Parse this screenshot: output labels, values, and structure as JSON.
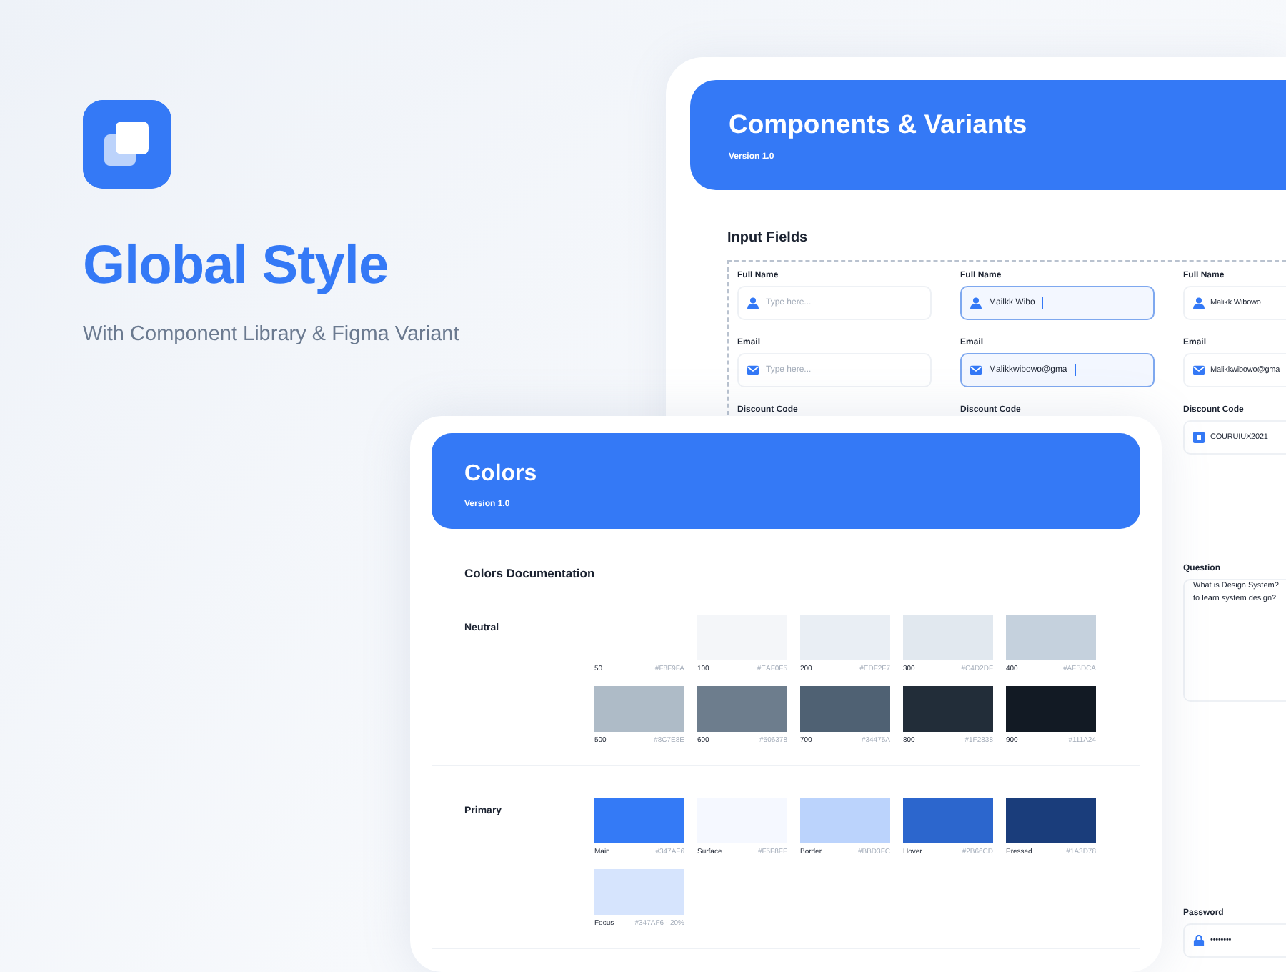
{
  "hero": {
    "title": "Global Style",
    "subtitle": "With Component Library & Figma Variant"
  },
  "components_card": {
    "title": "Components & Variants",
    "version": "Version 1.0",
    "section_title": "Input Fields",
    "columns": [
      {
        "fields": [
          {
            "label": "Full Name",
            "input": {
              "kind": "name",
              "placeholder": "Type here...",
              "focused": false
            }
          },
          {
            "label": "Email",
            "input": {
              "kind": "email",
              "placeholder": "Type here...",
              "focused": false
            }
          },
          {
            "label": "Discount Code"
          }
        ]
      },
      {
        "fields": [
          {
            "label": "Full Name",
            "input": {
              "kind": "name",
              "value": "Mailkk Wibo",
              "focused": true
            }
          },
          {
            "label": "Email",
            "input": {
              "kind": "email",
              "value": "Malikkwibowo@gma",
              "focused": true
            }
          },
          {
            "label": "Discount Code"
          }
        ]
      },
      {
        "fields": [
          {
            "label": "Full Name",
            "input": {
              "kind": "name",
              "value": "Malikk Wibowo",
              "focused": false
            }
          },
          {
            "label": "Email",
            "input": {
              "kind": "email",
              "value": "Malikkwibowo@gma",
              "focused": false
            }
          },
          {
            "label": "Discount Code",
            "input": {
              "kind": "code",
              "value": "COURUIUX2021",
              "focused": false
            }
          },
          {
            "label": "Question",
            "input": {
              "kind": "textarea",
              "lines": [
                "What is Design System?",
                "to learn system design?"
              ],
              "focused": false
            }
          },
          {
            "label": "Password",
            "input": {
              "kind": "password",
              "value": "••••••••",
              "focused": false
            }
          }
        ]
      }
    ]
  },
  "colors_card": {
    "title": "Colors",
    "version": "Version 1.0",
    "section_title": "Colors Documentation",
    "groups": [
      {
        "name": "Neutral",
        "swatches": [
          {
            "name": "50",
            "hex": "#F8F9FA"
          },
          {
            "name": "100",
            "hex": "#EAF0F5",
            "color": "#f4f6f9"
          },
          {
            "name": "200",
            "hex": "#EDF2F7",
            "color": "#e9eef4"
          },
          {
            "name": "300",
            "hex": "#C4D2DF",
            "color": "#e1e8ef"
          },
          {
            "name": "400",
            "hex": "#AFBDCA",
            "color": "#c5d1dd"
          },
          {
            "name": "500",
            "hex": "#8C7E8E",
            "color": "#aebbc7"
          },
          {
            "name": "600",
            "hex": "#506378",
            "color": "#6d7d8d"
          },
          {
            "name": "700",
            "hex": "#34475A",
            "color": "#4f6173"
          },
          {
            "name": "800",
            "hex": "#1F2838",
            "color": "#222d39"
          },
          {
            "name": "900",
            "hex": "#111A24",
            "color": "#121a24"
          }
        ]
      },
      {
        "name": "Primary",
        "swatches": [
          {
            "name": "Main",
            "hex": "#347AF6",
            "color": "#347af6"
          },
          {
            "name": "Surface",
            "hex": "#F5F8FF",
            "color": "#f5f8ff"
          },
          {
            "name": "Border",
            "hex": "#BBD3FC",
            "color": "#bbd3fc"
          },
          {
            "name": "Hover",
            "hex": "#2B66CD",
            "color": "#2c66cd"
          },
          {
            "name": "Pressed",
            "hex": "#1A3D78",
            "color": "#1a3d7b"
          },
          {
            "name": "Focus",
            "hex": "#347AF6 - 20%",
            "color": "#d6e4fd"
          }
        ]
      }
    ]
  }
}
